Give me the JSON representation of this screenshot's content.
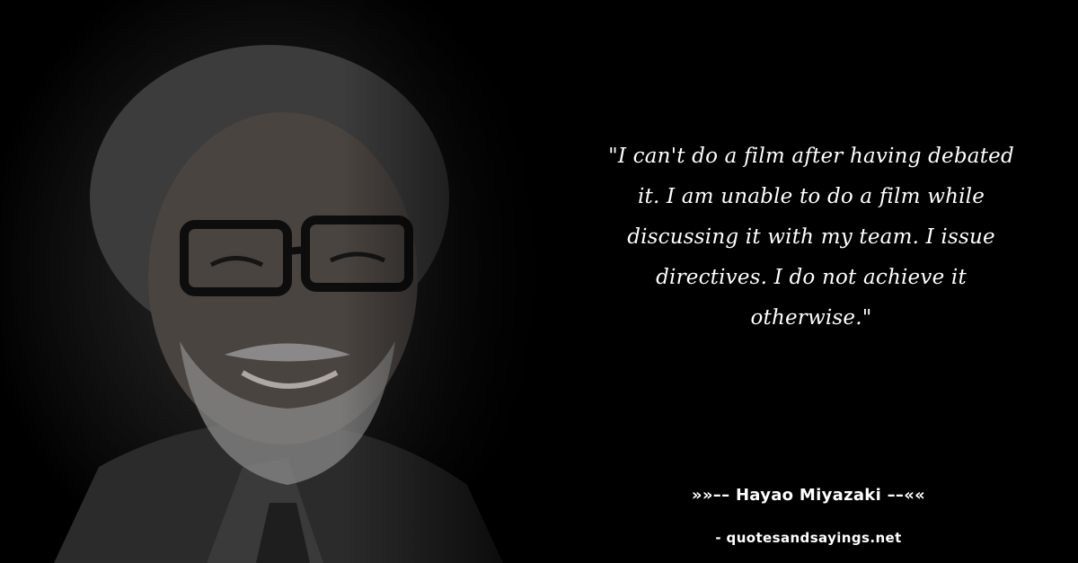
{
  "quote": {
    "text": "\"I can't do a film after having debated it. I am unable to do a film while discussing it with my team. I issue directives. I do not achieve it otherwise.\"",
    "author": "»»–– Hayao Miyazaki ––««",
    "source": "- quotesandsayings.net"
  },
  "colors": {
    "background": "#000000",
    "text": "#ffffff"
  },
  "image": {
    "subject": "portrait-photo",
    "tone": "dark-desaturated"
  }
}
